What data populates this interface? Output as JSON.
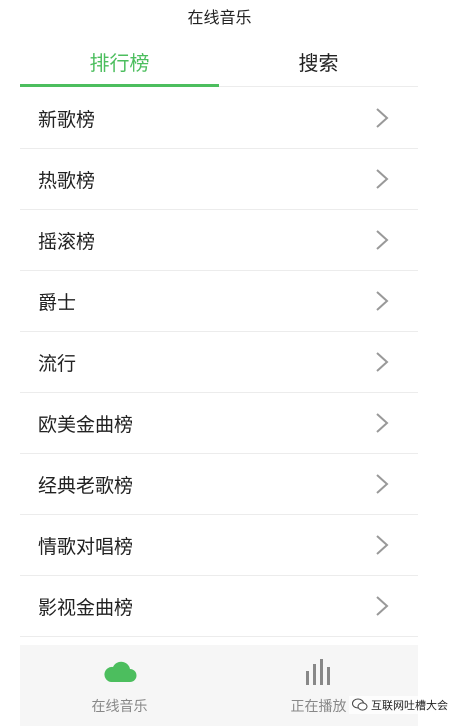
{
  "header": {
    "title": "在线音乐"
  },
  "tabs": [
    {
      "label": "排行榜",
      "active": true
    },
    {
      "label": "搜索",
      "active": false
    }
  ],
  "charts": [
    {
      "label": "新歌榜"
    },
    {
      "label": "热歌榜"
    },
    {
      "label": "摇滚榜"
    },
    {
      "label": "爵士"
    },
    {
      "label": "流行"
    },
    {
      "label": "欧美金曲榜"
    },
    {
      "label": "经典老歌榜"
    },
    {
      "label": "情歌对唱榜"
    },
    {
      "label": "影视金曲榜"
    }
  ],
  "bottom_nav": [
    {
      "label": "在线音乐",
      "icon": "cloud-icon",
      "active": true
    },
    {
      "label": "正在播放",
      "icon": "equalizer-icon",
      "active": false
    }
  ],
  "watermark": {
    "text": "互联网吐槽大会",
    "icon": "wechat-icon"
  },
  "colors": {
    "accent": "#4cbe5e",
    "text": "#222222",
    "divider": "#ececec",
    "nav_bg": "#f6f6f6",
    "chevron": "#999999"
  }
}
